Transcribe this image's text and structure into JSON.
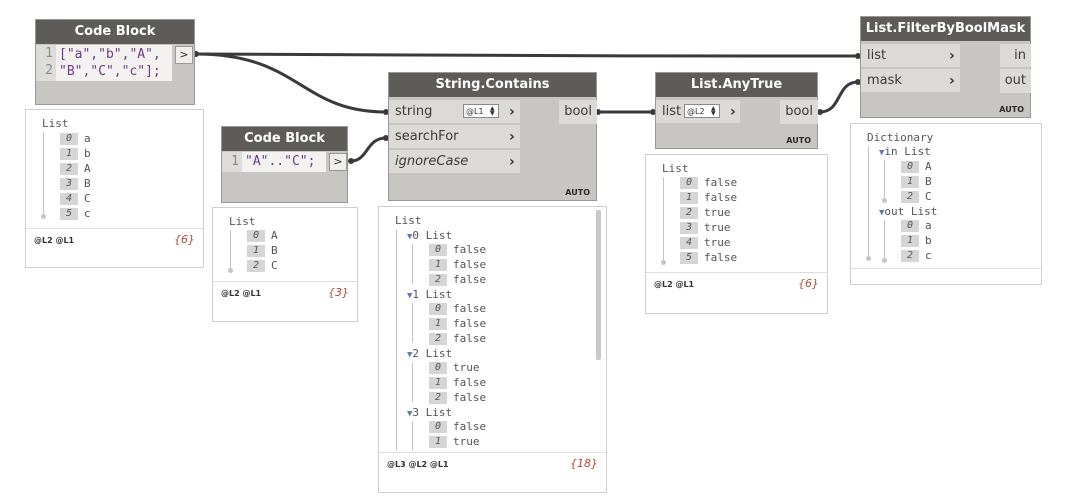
{
  "code_block_1": {
    "title": "Code Block",
    "line_numbers": [
      "1",
      "2"
    ],
    "lines": [
      "[\"a\",\"b\",\"A\",",
      "\"B\",\"C\",\"c\"];"
    ],
    "output_glyph": ">",
    "preview": {
      "header": "List",
      "items": [
        {
          "index": "0",
          "value": "a"
        },
        {
          "index": "1",
          "value": "b"
        },
        {
          "index": "2",
          "value": "A"
        },
        {
          "index": "3",
          "value": "B"
        },
        {
          "index": "4",
          "value": "C"
        },
        {
          "index": "5",
          "value": "c"
        }
      ],
      "levels": "@L2 @L1",
      "count": "{6}"
    }
  },
  "code_block_2": {
    "title": "Code Block",
    "line_numbers": [
      "1"
    ],
    "lines": [
      "\"A\"..\"C\";"
    ],
    "output_glyph": ">",
    "preview": {
      "header": "List",
      "items": [
        {
          "index": "0",
          "value": "A"
        },
        {
          "index": "1",
          "value": "B"
        },
        {
          "index": "2",
          "value": "C"
        }
      ],
      "levels": "@L2 @L1",
      "count": "{3}"
    }
  },
  "string_contains": {
    "title": "String.Contains",
    "inputs": [
      "string",
      "searchFor",
      "ignoreCase"
    ],
    "lacing": "@L1",
    "output": "bool",
    "badge": "AUTO",
    "preview": {
      "header": "List",
      "groups": [
        {
          "label": "0 List",
          "items": [
            {
              "index": "0",
              "value": "false"
            },
            {
              "index": "1",
              "value": "false"
            },
            {
              "index": "2",
              "value": "false"
            }
          ]
        },
        {
          "label": "1 List",
          "items": [
            {
              "index": "0",
              "value": "false"
            },
            {
              "index": "1",
              "value": "false"
            },
            {
              "index": "2",
              "value": "false"
            }
          ]
        },
        {
          "label": "2 List",
          "items": [
            {
              "index": "0",
              "value": "true"
            },
            {
              "index": "1",
              "value": "false"
            },
            {
              "index": "2",
              "value": "false"
            }
          ]
        },
        {
          "label": "3 List",
          "items": [
            {
              "index": "0",
              "value": "false"
            },
            {
              "index": "1",
              "value": "true"
            }
          ]
        }
      ],
      "levels": "@L3 @L2 @L1",
      "count": "{18}"
    }
  },
  "list_anytrue": {
    "title": "List.AnyTrue",
    "input": "list",
    "lacing": "@L2",
    "output": "bool",
    "badge": "AUTO",
    "preview": {
      "header": "List",
      "items": [
        {
          "index": "0",
          "value": "false"
        },
        {
          "index": "1",
          "value": "false"
        },
        {
          "index": "2",
          "value": "true"
        },
        {
          "index": "3",
          "value": "true"
        },
        {
          "index": "4",
          "value": "true"
        },
        {
          "index": "5",
          "value": "false"
        }
      ],
      "levels": "@L2 @L1",
      "count": "{6}"
    }
  },
  "filter_by_bool_mask": {
    "title": "List.FilterByBoolMask",
    "inputs": [
      "list",
      "mask"
    ],
    "outputs": [
      "in",
      "out"
    ],
    "badge": "AUTO",
    "preview": {
      "header": "Dictionary",
      "groups": [
        {
          "label": "in List",
          "items": [
            {
              "index": "0",
              "value": "A"
            },
            {
              "index": "1",
              "value": "B"
            },
            {
              "index": "2",
              "value": "C"
            }
          ]
        },
        {
          "label": "out List",
          "items": [
            {
              "index": "0",
              "value": "a"
            },
            {
              "index": "1",
              "value": "b"
            },
            {
              "index": "2",
              "value": "c"
            }
          ]
        }
      ]
    }
  },
  "colors": {
    "header": "#5e5c59",
    "node_body": "#c8c6c3",
    "wire": "#3a3a3a",
    "count": "#b04a32",
    "code_text": "#6d3b8a"
  }
}
